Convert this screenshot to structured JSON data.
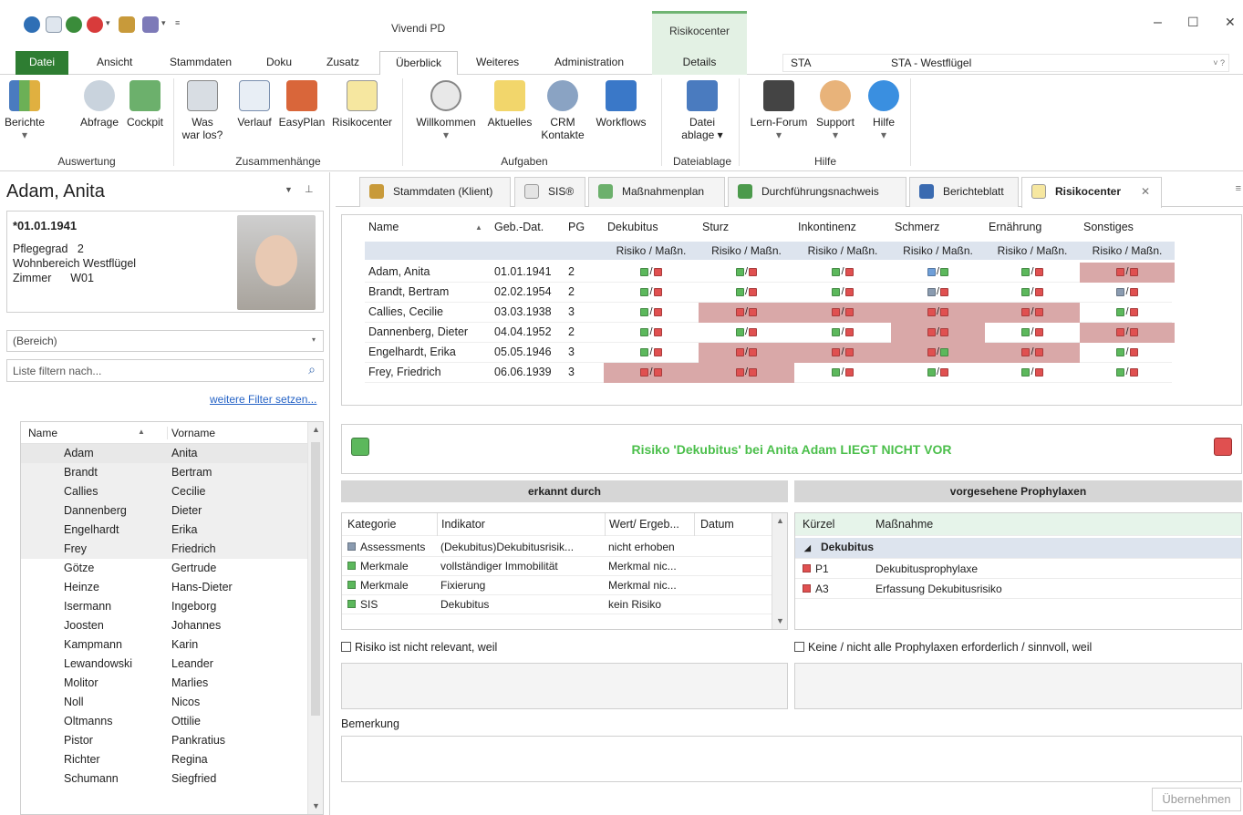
{
  "window": {
    "title": "Vivendi PD",
    "context_tab_title": "Risikocenter",
    "controls": {
      "minimize": "–",
      "maximize": "☐",
      "close": "✕"
    }
  },
  "ribbon_tabs": [
    "Datei",
    "Ansicht",
    "Stammdaten",
    "Doku",
    "Zusatz",
    "Überblick",
    "Weiteres",
    "Administration",
    "Details"
  ],
  "station": {
    "code": "STA",
    "name": "STA - Westflügel",
    "help": "˅ ?"
  },
  "ribbon": {
    "buttons": [
      {
        "label": "Berichte",
        "sub": "▾"
      },
      {
        "label": "Abfrage",
        "sub": ""
      },
      {
        "label": "Cockpit",
        "sub": ""
      },
      {
        "label": "Was",
        "sub": "war los?"
      },
      {
        "label": "Verlauf",
        "sub": ""
      },
      {
        "label": "EasyPlan",
        "sub": ""
      },
      {
        "label": "Risikocenter",
        "sub": ""
      },
      {
        "label": "Willkommen",
        "sub": "▾"
      },
      {
        "label": "Aktuelles",
        "sub": ""
      },
      {
        "label": "CRM",
        "sub": "Kontakte"
      },
      {
        "label": "Workflows",
        "sub": ""
      },
      {
        "label": "Datei",
        "sub": "ablage ▾"
      },
      {
        "label": "Lern-Forum",
        "sub": "▾"
      },
      {
        "label": "Support",
        "sub": "▾"
      },
      {
        "label": "Hilfe",
        "sub": "▾"
      }
    ],
    "groups": [
      "Auswertung",
      "Zusammenhänge",
      "Aufgaben",
      "Dateiablage",
      "Hilfe"
    ]
  },
  "patient": {
    "name": "Adam, Anita",
    "birth": "*01.01.1941",
    "pflegegrad_label": "Pflegegrad",
    "pflegegrad": "2",
    "wohnbereich_label": "Wohnbereich",
    "wohnbereich": "Westflügel",
    "zimmer_label": "Zimmer",
    "zimmer": "W01"
  },
  "filter": {
    "bereich": "(Bereich)",
    "placeholder": "Liste filtern nach...",
    "more_link": "weitere Filter setzen..."
  },
  "person_list": {
    "headers": [
      "Name",
      "Vorname"
    ],
    "rows": [
      [
        "Adam",
        "Anita"
      ],
      [
        "Brandt",
        "Bertram"
      ],
      [
        "Callies",
        "Cecilie"
      ],
      [
        "Dannenberg",
        "Dieter"
      ],
      [
        "Engelhardt",
        "Erika"
      ],
      [
        "Frey",
        "Friedrich"
      ],
      [
        "Götze",
        "Gertrude"
      ],
      [
        "Heinze",
        "Hans-Dieter"
      ],
      [
        "Isermann",
        "Ingeborg"
      ],
      [
        "Joosten",
        "Johannes"
      ],
      [
        "Kampmann",
        "Karin"
      ],
      [
        "Lewandowski",
        "Leander"
      ],
      [
        "Molitor",
        "Marlies"
      ],
      [
        "Noll",
        "Nicos"
      ],
      [
        "Oltmanns",
        "Ottilie"
      ],
      [
        "Pistor",
        "Pankratius"
      ],
      [
        "Richter",
        "Regina"
      ],
      [
        "Schumann",
        "Siegfried"
      ]
    ]
  },
  "doc_tabs": [
    "Stammdaten (Klient)",
    "SIS®",
    "Maßnahmenplan",
    "Durchführungsnachweis",
    "Berichteblatt",
    "Risikocenter"
  ],
  "risk_grid": {
    "headers": [
      "Name",
      "Geb.-Dat.",
      "PG",
      "Dekubitus",
      "Sturz",
      "Inkontinenz",
      "Schmerz",
      "Ernährung",
      "Sonstiges"
    ],
    "subheader": "Risiko / Maßn.",
    "colors": {
      "green": "#5cb85c",
      "red": "#e05050",
      "gray": "#8a9bb0",
      "blue": "#6f9fd8",
      "alert_bg": "#d9a8a8"
    },
    "rows": [
      {
        "name": "Adam, Anita",
        "dob": "01.01.1941",
        "pg": "2",
        "cells": [
          [
            "g",
            "r",
            0
          ],
          [
            "g",
            "r",
            0
          ],
          [
            "g",
            "r",
            0
          ],
          [
            "b",
            "g",
            0
          ],
          [
            "g",
            "r",
            0
          ],
          [
            "r",
            "r",
            1
          ]
        ]
      },
      {
        "name": "Brandt, Bertram",
        "dob": "02.02.1954",
        "pg": "2",
        "cells": [
          [
            "g",
            "r",
            0
          ],
          [
            "g",
            "r",
            0
          ],
          [
            "g",
            "r",
            0
          ],
          [
            "x",
            "r",
            0
          ],
          [
            "g",
            "r",
            0
          ],
          [
            "x",
            "r",
            0
          ]
        ]
      },
      {
        "name": "Callies, Cecilie",
        "dob": "03.03.1938",
        "pg": "3",
        "cells": [
          [
            "g",
            "r",
            0
          ],
          [
            "r",
            "r",
            1
          ],
          [
            "r",
            "r",
            1
          ],
          [
            "r",
            "r",
            1
          ],
          [
            "r",
            "r",
            1
          ],
          [
            "g",
            "r",
            0
          ]
        ]
      },
      {
        "name": "Dannenberg, Dieter",
        "dob": "04.04.1952",
        "pg": "2",
        "cells": [
          [
            "g",
            "r",
            0
          ],
          [
            "g",
            "r",
            0
          ],
          [
            "g",
            "r",
            0
          ],
          [
            "r",
            "r",
            1
          ],
          [
            "g",
            "r",
            0
          ],
          [
            "r",
            "r",
            1
          ]
        ]
      },
      {
        "name": "Engelhardt, Erika",
        "dob": "05.05.1946",
        "pg": "3",
        "cells": [
          [
            "g",
            "r",
            0
          ],
          [
            "r",
            "r",
            1
          ],
          [
            "r",
            "r",
            1
          ],
          [
            "r",
            "g",
            1
          ],
          [
            "r",
            "r",
            1
          ],
          [
            "g",
            "r",
            0
          ]
        ]
      },
      {
        "name": "Frey, Friedrich",
        "dob": "06.06.1939",
        "pg": "3",
        "cells": [
          [
            "r",
            "r",
            1
          ],
          [
            "r",
            "r",
            1
          ],
          [
            "g",
            "r",
            0
          ],
          [
            "g",
            "r",
            0
          ],
          [
            "g",
            "r",
            0
          ],
          [
            "g",
            "r",
            0
          ]
        ]
      }
    ]
  },
  "status_message": "Risiko 'Dekubitus' bei Anita Adam LIEGT NICHT VOR",
  "erkannt": {
    "title": "erkannt durch",
    "headers": [
      "Kategorie",
      "Indikator",
      "Wert/ Ergeb...",
      "Datum"
    ],
    "rows": [
      {
        "kat": "Assessments",
        "ind": "(Dekubitus)Dekubitusrisik...",
        "wert": "nicht erhoben",
        "datum": "",
        "ic": "gray"
      },
      {
        "kat": "Merkmale",
        "ind": "vollständiger Immobilität",
        "wert": "Merkmal nic...",
        "datum": "",
        "ic": "green"
      },
      {
        "kat": "Merkmale",
        "ind": "Fixierung",
        "wert": "Merkmal nic...",
        "datum": "",
        "ic": "green"
      },
      {
        "kat": "SIS",
        "ind": "Dekubitus",
        "wert": "kein Risiko",
        "datum": "",
        "ic": "green"
      }
    ]
  },
  "prophylaxen": {
    "title": "vorgesehene Prophylaxen",
    "headers": [
      "Kürzel",
      "Maßnahme"
    ],
    "group": "Dekubitus",
    "rows": [
      {
        "code": "P1",
        "name": "Dekubitusprophylaxe"
      },
      {
        "code": "A3",
        "name": "Erfassung Dekubitusrisiko"
      }
    ]
  },
  "checkboxes": {
    "risk_not_relevant": "Risiko ist nicht relevant, weil",
    "no_prophylaxis": "Keine / nicht alle Prophylaxen erforderlich / sinnvoll, weil"
  },
  "remark_label": "Bemerkung",
  "apply_button": "Übernehmen"
}
